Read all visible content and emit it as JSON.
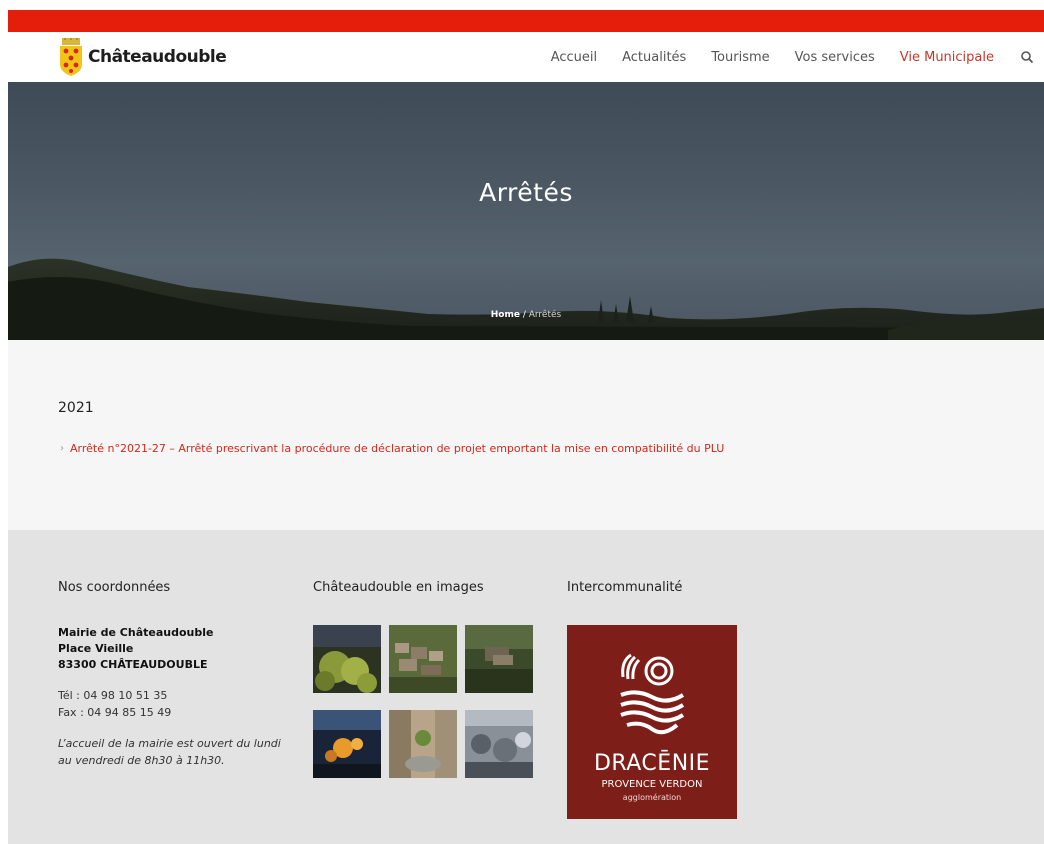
{
  "site": {
    "name": "Châteaudouble"
  },
  "nav": {
    "items": [
      "Accueil",
      "Actualités",
      "Tourisme",
      "Vos services",
      "Vie Municipale"
    ],
    "active_index": 4
  },
  "hero": {
    "title": "Arrêtés",
    "breadcrumb_home": "Home",
    "breadcrumb_sep": " / ",
    "breadcrumb_current": "Arrêtés"
  },
  "content": {
    "year": "2021",
    "decrees": [
      "Arrêté n°2021-27 – Arrêté prescrivant la procédure de déclaration de projet emportant la mise en compatibilité du PLU"
    ]
  },
  "footer": {
    "contact_title": "Nos coordonnées",
    "address": [
      "Mairie de Châteaudouble",
      "Place Vieille",
      "83300 CHÂTEAUDOUBLE"
    ],
    "phone": "Tél : 04 98 10 51 35",
    "fax": "Fax : 04 94 85 15 49",
    "hours_line1": "L’accueil de la mairie est ouvert du lundi",
    "hours_line2": "au vendredi de 8h30 à 11h30.",
    "images_title": "Châteaudouble en images",
    "inter_title": "Intercommunalité",
    "dracenie": {
      "name": "DRACĒNIE",
      "sub": "PROVENCE VERDON",
      "sub2": "agglomération"
    }
  },
  "colors": {
    "topbar": "#e41e0a",
    "accent": "#c0392b",
    "link": "#d4281c",
    "dracenie_bg": "#7e1e19"
  },
  "icons": {
    "search": "search-icon",
    "arrow": "chevron-right-icon",
    "crest": "coat-of-arms-icon"
  }
}
